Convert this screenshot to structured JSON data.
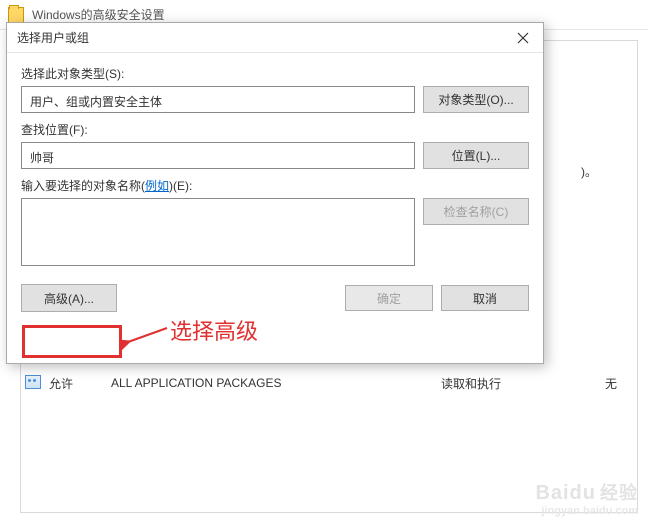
{
  "parent": {
    "title": "Windows的高级安全设置"
  },
  "dialog": {
    "title": "选择用户或组",
    "object_type_label": "选择此对象类型(S):",
    "object_type_value": "用户、组或内置安全主体",
    "object_types_btn": "对象类型(O)...",
    "location_label": "查找位置(F):",
    "location_value": "帅哥",
    "locations_btn": "位置(L)...",
    "names_label_pre": "输入要选择的对象名称(",
    "names_label_link": "例如",
    "names_label_post": ")(E):",
    "names_value": "",
    "check_names_btn": "检查名称(C)",
    "advanced_btn": "高级(A)...",
    "ok_btn": "确定",
    "cancel_btn": "取消"
  },
  "bg": {
    "trailing_paren": ")。",
    "allow": "允许",
    "principal": "ALL APPLICATION PACKAGES",
    "access": "读取和执行",
    "inherit": "无"
  },
  "annotation": {
    "text": "选择高级"
  },
  "watermark": {
    "brand": "Baidu",
    "cn": "经验",
    "url": "jingyan.baidu.com"
  }
}
